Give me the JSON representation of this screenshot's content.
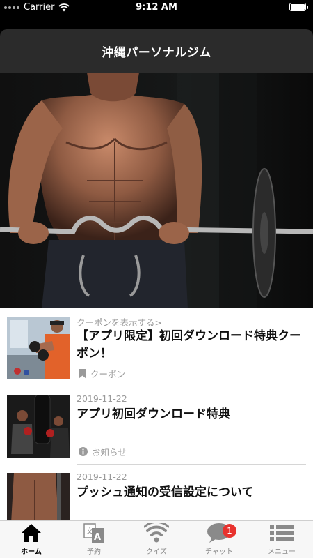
{
  "status": {
    "carrier": "Carrier",
    "time": "9:12 AM"
  },
  "header": {
    "title": "沖縄パーソナルジム"
  },
  "items": [
    {
      "meta": "クーポンを表示する>",
      "title": "【アプリ限定】初回ダウンロード特典クーポン！",
      "tag": "クーポン",
      "tag_icon": "bookmark-icon"
    },
    {
      "meta": "2019-11-22",
      "title": "アプリ初回ダウンロード特典",
      "tag": "お知らせ",
      "tag_icon": "info-icon"
    },
    {
      "meta": "2019-11-22",
      "title": "プッシュ通知の受信設定について",
      "tag": "",
      "tag_icon": ""
    }
  ],
  "tabs": [
    {
      "label": "ホーム",
      "icon": "home-icon",
      "active": true
    },
    {
      "label": "予約",
      "icon": "translate-icon",
      "active": false
    },
    {
      "label": "クイズ",
      "icon": "wifi-icon",
      "active": false
    },
    {
      "label": "チャット",
      "icon": "chat-bubble-icon",
      "active": false,
      "badge": "1"
    },
    {
      "label": "メニュー",
      "icon": "list-menu-icon",
      "active": false
    }
  ],
  "colors": {
    "badge": "#e8322e",
    "header_panel": "#2b2b2b",
    "active_tab": "#000000",
    "inactive_tab": "#8a8a8a"
  }
}
